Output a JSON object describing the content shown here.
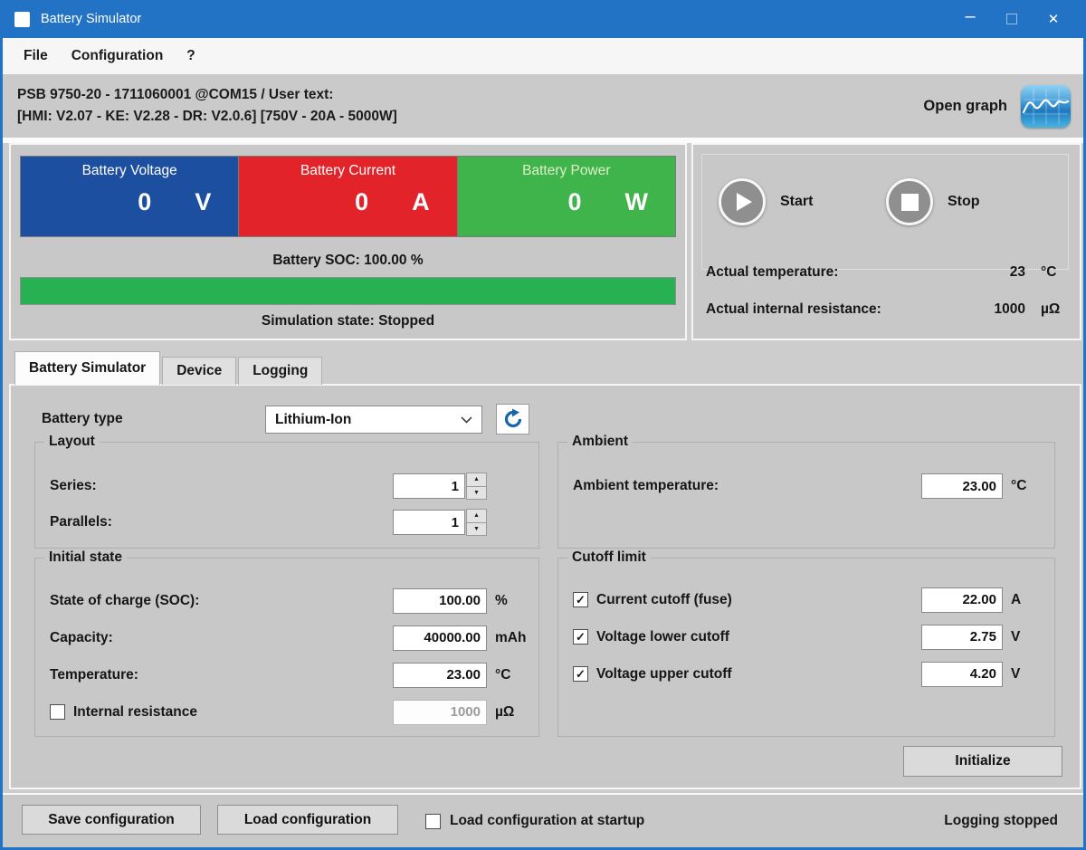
{
  "window": {
    "title": "Battery Simulator",
    "minimize_glyph": "–",
    "close_glyph": "✕"
  },
  "menu": {
    "file": "File",
    "configuration": "Configuration",
    "help": "?"
  },
  "infobar": {
    "line1": "PSB 9750-20 - 1711060001 @COM15 / User text:",
    "line2": "[HMI: V2.07 - KE: V2.28 - DR: V2.0.6] [750V - 20A - 5000W]",
    "open_graph": "Open graph"
  },
  "status": {
    "tiles": [
      {
        "label": "Battery Voltage",
        "value": "0",
        "unit": "V",
        "color": "#1d4fa1"
      },
      {
        "label": "Battery Current",
        "value": "0",
        "unit": "A",
        "color": "#e2232a"
      },
      {
        "label": "Battery Power",
        "value": "0",
        "unit": "W",
        "color": "#3eb44a"
      }
    ],
    "soc_label": "Battery SOC: 100.00 %",
    "soc_percent": 100,
    "soc_bar_color": "#28b152",
    "state_label": "Simulation state: Stopped"
  },
  "control": {
    "start": "Start",
    "stop": "Stop",
    "temp_label": "Actual temperature:",
    "temp_value": "23",
    "temp_unit": "°C",
    "res_label": "Actual internal resistance:",
    "res_value": "1000",
    "res_unit": "µΩ"
  },
  "tabs": {
    "sim": "Battery Simulator",
    "device": "Device",
    "logging": "Logging"
  },
  "sim": {
    "battery_type_label": "Battery type",
    "battery_type_value": "Lithium-Ion",
    "layout": {
      "title": "Layout",
      "series_label": "Series:",
      "series_value": "1",
      "parallels_label": "Parallels:",
      "parallels_value": "1"
    },
    "ambient": {
      "title": "Ambient",
      "temp_label": "Ambient temperature:",
      "temp_value": "23.00",
      "temp_unit": "°C"
    },
    "initial": {
      "title": "Initial state",
      "soc_label": "State of charge (SOC):",
      "soc_value": "100.00",
      "soc_unit": "%",
      "capacity_label": "Capacity:",
      "capacity_value": "40000.00",
      "capacity_unit": "mAh",
      "temp_label": "Temperature:",
      "temp_value": "23.00",
      "temp_unit": "°C",
      "resistance_label": "Internal resistance",
      "resistance_check": "",
      "resistance_value": "1000",
      "resistance_unit": "µΩ"
    },
    "cutoff": {
      "title": "Cutoff limit",
      "current_label": "Current cutoff (fuse)",
      "current_check": "✓",
      "current_value": "22.00",
      "current_unit": "A",
      "lower_label": "Voltage lower cutoff",
      "lower_check": "✓",
      "lower_value": "2.75",
      "lower_unit": "V",
      "upper_label": "Voltage upper cutoff",
      "upper_check": "✓",
      "upper_value": "4.20",
      "upper_unit": "V"
    },
    "initialize": "Initialize"
  },
  "footer": {
    "save": "Save configuration",
    "load": "Load configuration",
    "startup_label": "Load configuration at startup",
    "startup_check": "",
    "status": "Logging stopped"
  },
  "glyphs": {
    "spin_up": "▲",
    "spin_down": "▼"
  },
  "colors": {
    "titlebar": "#2273c6",
    "accent_icon_blue": "#1565a8",
    "window_border": "#2273c6"
  }
}
